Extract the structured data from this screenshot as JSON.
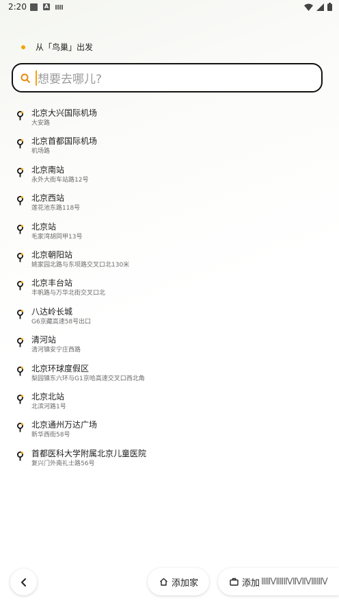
{
  "status_bar": {
    "time": "2:20",
    "a_badge": "A"
  },
  "origin": {
    "text": "从「鸟巢」出发"
  },
  "search": {
    "placeholder": "想要去哪儿?"
  },
  "places": [
    {
      "name": "北京大兴国际机场",
      "address": "大安路"
    },
    {
      "name": "北京首都国际机场",
      "address": "机场路"
    },
    {
      "name": "北京南站",
      "address": "永外大街车站路12号"
    },
    {
      "name": "北京西站",
      "address": "莲花池东路118号"
    },
    {
      "name": "北京站",
      "address": "毛家湾胡同甲13号"
    },
    {
      "name": "北京朝阳站",
      "address": "姚家园北路与东坝路交叉口北130米"
    },
    {
      "name": "北京丰台站",
      "address": "丰帆路与万华北街交叉口北"
    },
    {
      "name": "八达岭长城",
      "address": "G6京藏高速58号出口"
    },
    {
      "name": "清河站",
      "address": "清河镇安宁庄西路"
    },
    {
      "name": "北京环球度假区",
      "address": "梨园镇东六环与G1京哈高速交叉口西北角"
    },
    {
      "name": "北京北站",
      "address": "北滨河路1号"
    },
    {
      "name": "北京通州万达广场",
      "address": "新华西街58号"
    },
    {
      "name": "首都医科大学附属北京儿童医院",
      "address": "复兴门外南礼士路56号"
    }
  ],
  "bottom_bar": {
    "home_label": "添加家",
    "work_label": "添加",
    "work_label_overflow": "⁠ⅡⅢⅦⅡⅡⅦⅦⅧⅢⅤ"
  },
  "colors": {
    "accent": "#f2a400",
    "border": "#111111"
  },
  "icons": {
    "search": "search-icon",
    "pin": "location-pin-icon",
    "back": "chevron-left-icon",
    "home": "home-icon",
    "work": "briefcase-icon"
  }
}
